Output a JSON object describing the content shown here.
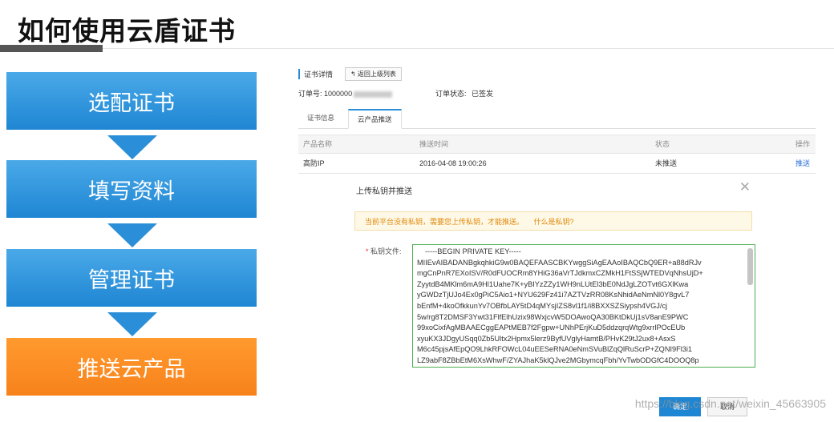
{
  "slide": {
    "title": "如何使用云盾证书"
  },
  "steps": [
    {
      "label": "选配证书",
      "color": "#2a8fd8"
    },
    {
      "label": "填写资料",
      "color": "#2a8fd8"
    },
    {
      "label": "管理证书",
      "color": "#2a8fd8"
    },
    {
      "label": "推送云产品",
      "color": "#f7821b"
    }
  ],
  "detail": {
    "crumb": "证书详情",
    "back_button": "↰ 返回上级列表",
    "order_no_label": "订单号:",
    "order_no_value": "1000000",
    "order_status_label": "订单状态:",
    "order_status_value": "已签发",
    "tabs": [
      "证书信息",
      "云产品推送"
    ],
    "table": {
      "headers": [
        "产品名称",
        "推送时间",
        "状态",
        "操作"
      ],
      "rows": [
        {
          "product": "高防IP",
          "time": "2016-04-08 19:00:26",
          "status": "未推送",
          "action": "推送"
        }
      ]
    }
  },
  "modal": {
    "title": "上传私钥并推送",
    "close": "✕",
    "warning": "当前平台没有私钥，需要您上传私钥，才能推送。",
    "warning_link": "什么是私钥?",
    "key_label": "私钥文件:",
    "key_required_mark": "*",
    "key_lines": [
      "-----BEGIN PRIVATE KEY-----",
      "MIIEvAIBADANBgkqhkiG9w0BAQEFAASCBKYwggSiAgEAAoIBAQCbQ9ER+a88dRJv",
      "mgCnPnR7EXoISV/R0dFUOCRm8YHiG36aVrTJdkmxCZMkH1FtSSjWTEDVqNhsUjD+",
      "ZyytdB4MKlm6mA9Hl1Uahe7K+yBIYzZZy1WH9nLUtEl3bE0NdJgLZOTvt6GXlKwa",
      "yGWDzTjUJo4Ex0gPiC5Aio1+NYU629Fz41i7AZTVzRR08KsNhidAeNmNl0Y8gvL7",
      "bEnfM+4koOfkkunYv7OBfbLAY5tD4qMYsjIZS8vl1f1/i8BXXSZSiypsh4VGJ/cj",
      "5w/rg8T2DMSF3Ywt31FlfElhUzix98WxjcvW5DOAwoQA30BKtDkUj1sV8anE9PWC",
      "99xoCixfAgMBAAECggEAPtMEB7f2Fgpw+UNhPErjKuD5ddzqrqWtg9xrrlPOcEUb",
      "xyuKX3JDgyUSqq0Zb5Ultx2Hpmx5lerz9ByfUVglyHamtB/PHvK29tJ2ux8+AsxS",
      "M6c45pjsAfEpQO9LhkRFOWcL04uEESeRNA0eNmSVuBlZqQlRuScrP+ZQNI9Fl3i1",
      "LZ9abF8ZBbEtM6XsWhwF/ZYAJhaK5klQJve2MGbymcqFbh/YvTwbODGfC4DOOQ8p"
    ],
    "ok_label": "确定",
    "cancel_label": "取消"
  },
  "watermark": "https://blog.csdn.net/weixin_45663905"
}
